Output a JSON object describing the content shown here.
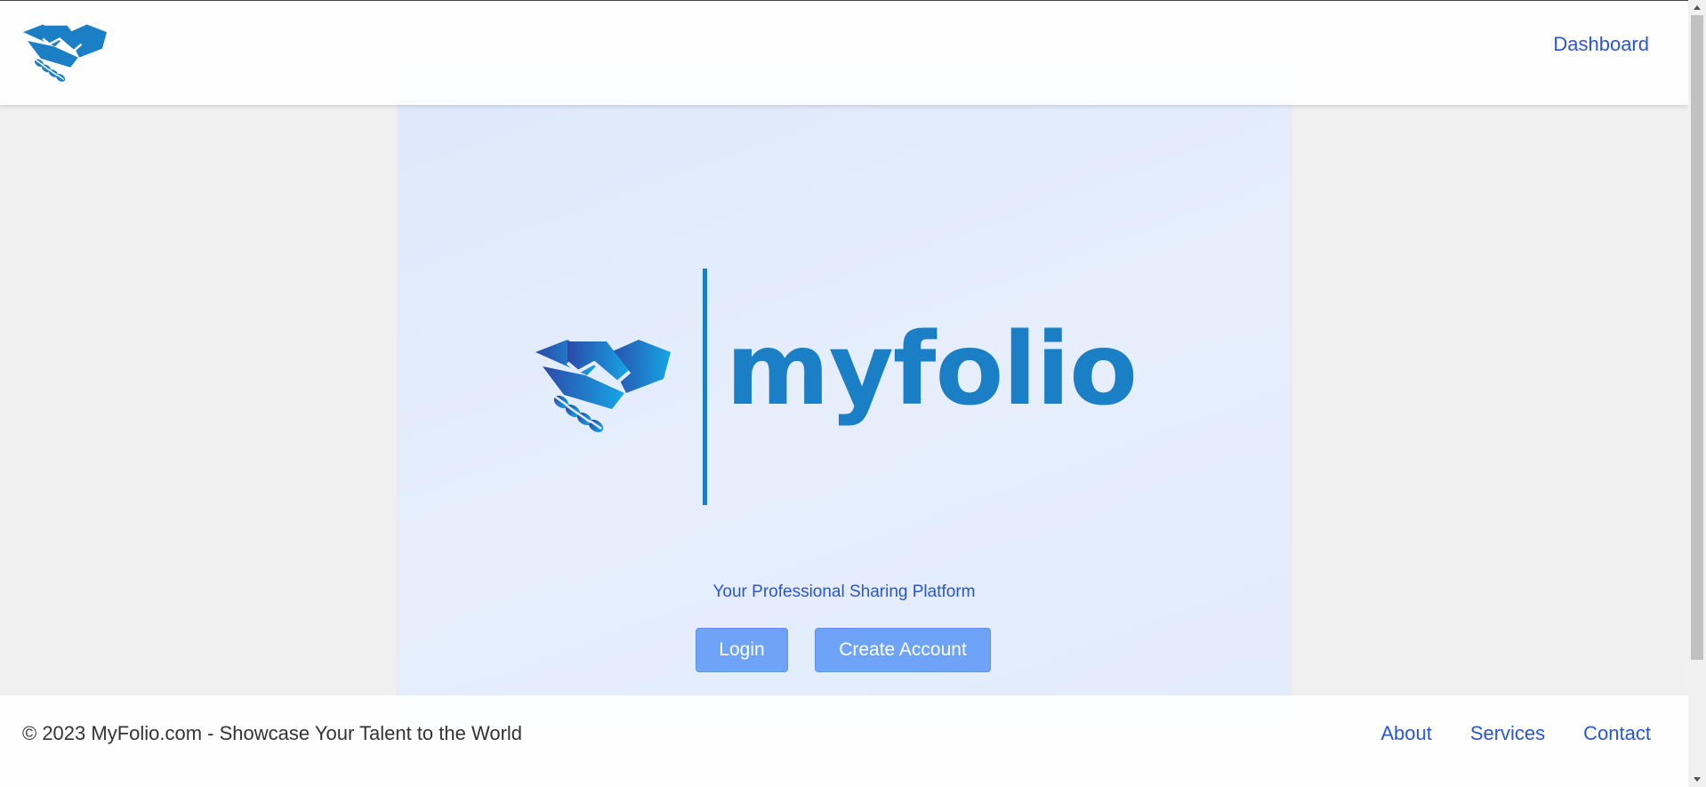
{
  "navbar": {
    "logo_icon": "handshake-icon",
    "dashboard_label": "Dashboard"
  },
  "hero": {
    "brand_icon": "handshake-icon",
    "brand_name": "myfolio",
    "tagline": "Your Professional Sharing Platform",
    "login_label": "Login",
    "create_account_label": "Create Account"
  },
  "footer": {
    "copyright": "© 2023 MyFolio.com - Showcase Your Talent to the World",
    "links": [
      {
        "label": "About"
      },
      {
        "label": "Services"
      },
      {
        "label": "Contact"
      }
    ]
  },
  "colors": {
    "brand_blue": "#1b7fc6",
    "link_blue": "#2a55d6",
    "button_blue": "#6ea3f7",
    "hero_bg": "#e3ecfb",
    "page_bg": "#f0f0f0"
  }
}
